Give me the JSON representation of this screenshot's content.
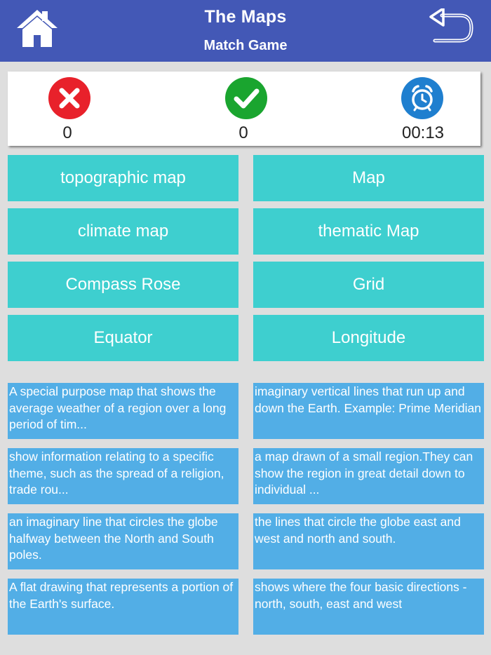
{
  "header": {
    "title": "The Maps",
    "subtitle": "Match Game"
  },
  "score": {
    "wrong": "0",
    "correct": "0",
    "timer": "00:13",
    "colors": {
      "wrong": "#e8212b",
      "correct": "#1aa52f",
      "timer": "#1f7fcf"
    }
  },
  "terms": [
    "topographic map",
    "Map",
    "climate map",
    "thematic Map",
    "Compass Rose",
    "Grid",
    "Equator",
    "Longitude"
  ],
  "definitions": [
    "A special purpose map that shows the average weather of a region over a long period of tim...",
    "imaginary vertical lines that run up and down the Earth. Example: Prime Meridian",
    "show information relating to a specific theme, such as the spread of a religion, trade rou...",
    "a map drawn of a small region.They can show the region in great detail down to individual ...",
    "an imaginary line that circles the globe halfway between the North and South poles.",
    "the lines that circle the globe east and west and north and south.",
    "A flat drawing that represents a portion of the Earth's surface.",
    "shows where the four basic directions - north, south, east and west"
  ],
  "icons": {
    "home": "home-icon",
    "back": "back-arrow-icon",
    "wrong": "x-circle-icon",
    "correct": "check-circle-icon",
    "timer": "alarm-clock-icon"
  }
}
